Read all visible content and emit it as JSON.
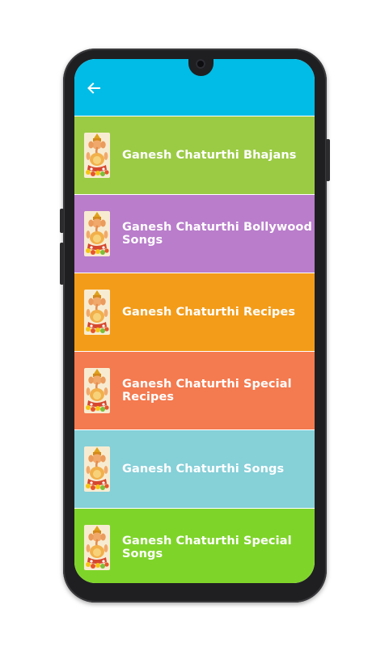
{
  "header": {
    "color": "#00BCE6",
    "back_icon": "arrow-left-icon"
  },
  "items": [
    {
      "label": "Ganesh Chaturthi Bhajans",
      "color": "#9BCB45",
      "icon": "ganesha-image"
    },
    {
      "label": "Ganesh Chaturthi Bollywood Songs",
      "color": "#B97DCB",
      "icon": "ganesha-image"
    },
    {
      "label": "Ganesh Chaturthi Recipes",
      "color": "#F39C19",
      "icon": "ganesha-image"
    },
    {
      "label": "Ganesh Chaturthi Special Recipes",
      "color": "#F47A4F",
      "icon": "ganesha-image"
    },
    {
      "label": "Ganesh Chaturthi Songs",
      "color": "#86D0D8",
      "icon": "ganesha-image"
    },
    {
      "label": "Ganesh Chaturthi Special Songs",
      "color": "#7FD42A",
      "icon": "ganesha-image"
    }
  ]
}
